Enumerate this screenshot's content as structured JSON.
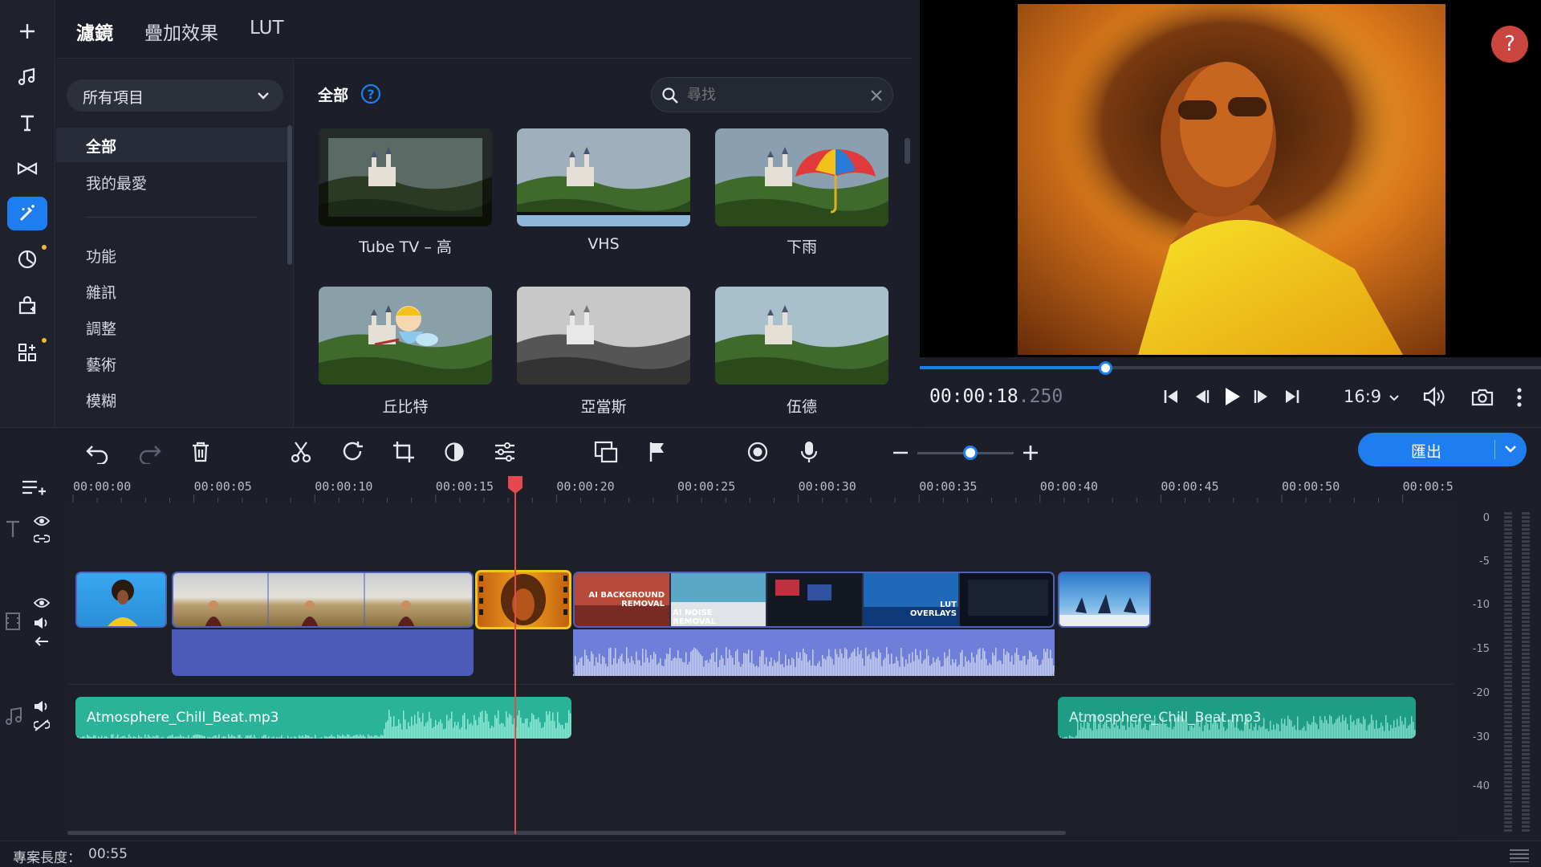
{
  "filter_panel": {
    "tabs": [
      "濾鏡",
      "疊加效果",
      "LUT"
    ],
    "dropdown_value": "所有項目",
    "categories_top": [
      "全部",
      "我的最愛"
    ],
    "categories": [
      "功能",
      "雜訊",
      "調整",
      "藝術",
      "模糊"
    ],
    "section_title": "全部",
    "search_placeholder": "尋找",
    "filters": [
      "Tube TV – 高",
      "VHS",
      "下雨",
      "丘比特",
      "亞當斯",
      "伍德"
    ]
  },
  "player": {
    "time_main": "00:00:18",
    "time_ms": ".250",
    "aspect": "16:9",
    "progress": 0.3,
    "help_label": "?"
  },
  "toolbar": {
    "export_label": "匯出",
    "zoom_level": 0.55
  },
  "timeline": {
    "ruler_labels": [
      "00:00:00",
      "00:00:05",
      "00:00:10",
      "00:00:15",
      "00:00:20",
      "00:00:25",
      "00:00:30",
      "00:00:35",
      "00:00:40",
      "00:00:45",
      "00:00:50",
      "00:00:5"
    ],
    "meter_labels": [
      "0",
      "-5",
      "-10",
      "-15",
      "-20",
      "-30",
      "-40"
    ],
    "audio_clips": [
      "Atmosphere_Chill_Beat.mp3",
      "Atmosphere_Chill_Beat.mp3"
    ],
    "overlay_texts": [
      "AI BACKGROUND REMOVAL",
      "AI NOISE REMOVAL",
      "LUT OVERLAYS"
    ]
  },
  "status": {
    "label": "專案長度：",
    "value": "00:55"
  },
  "colors": {
    "accent": "#1e7ef0",
    "playhead": "#e5484d",
    "audio_clip": "#2bb39a",
    "video_audio": "#5a67c7"
  }
}
